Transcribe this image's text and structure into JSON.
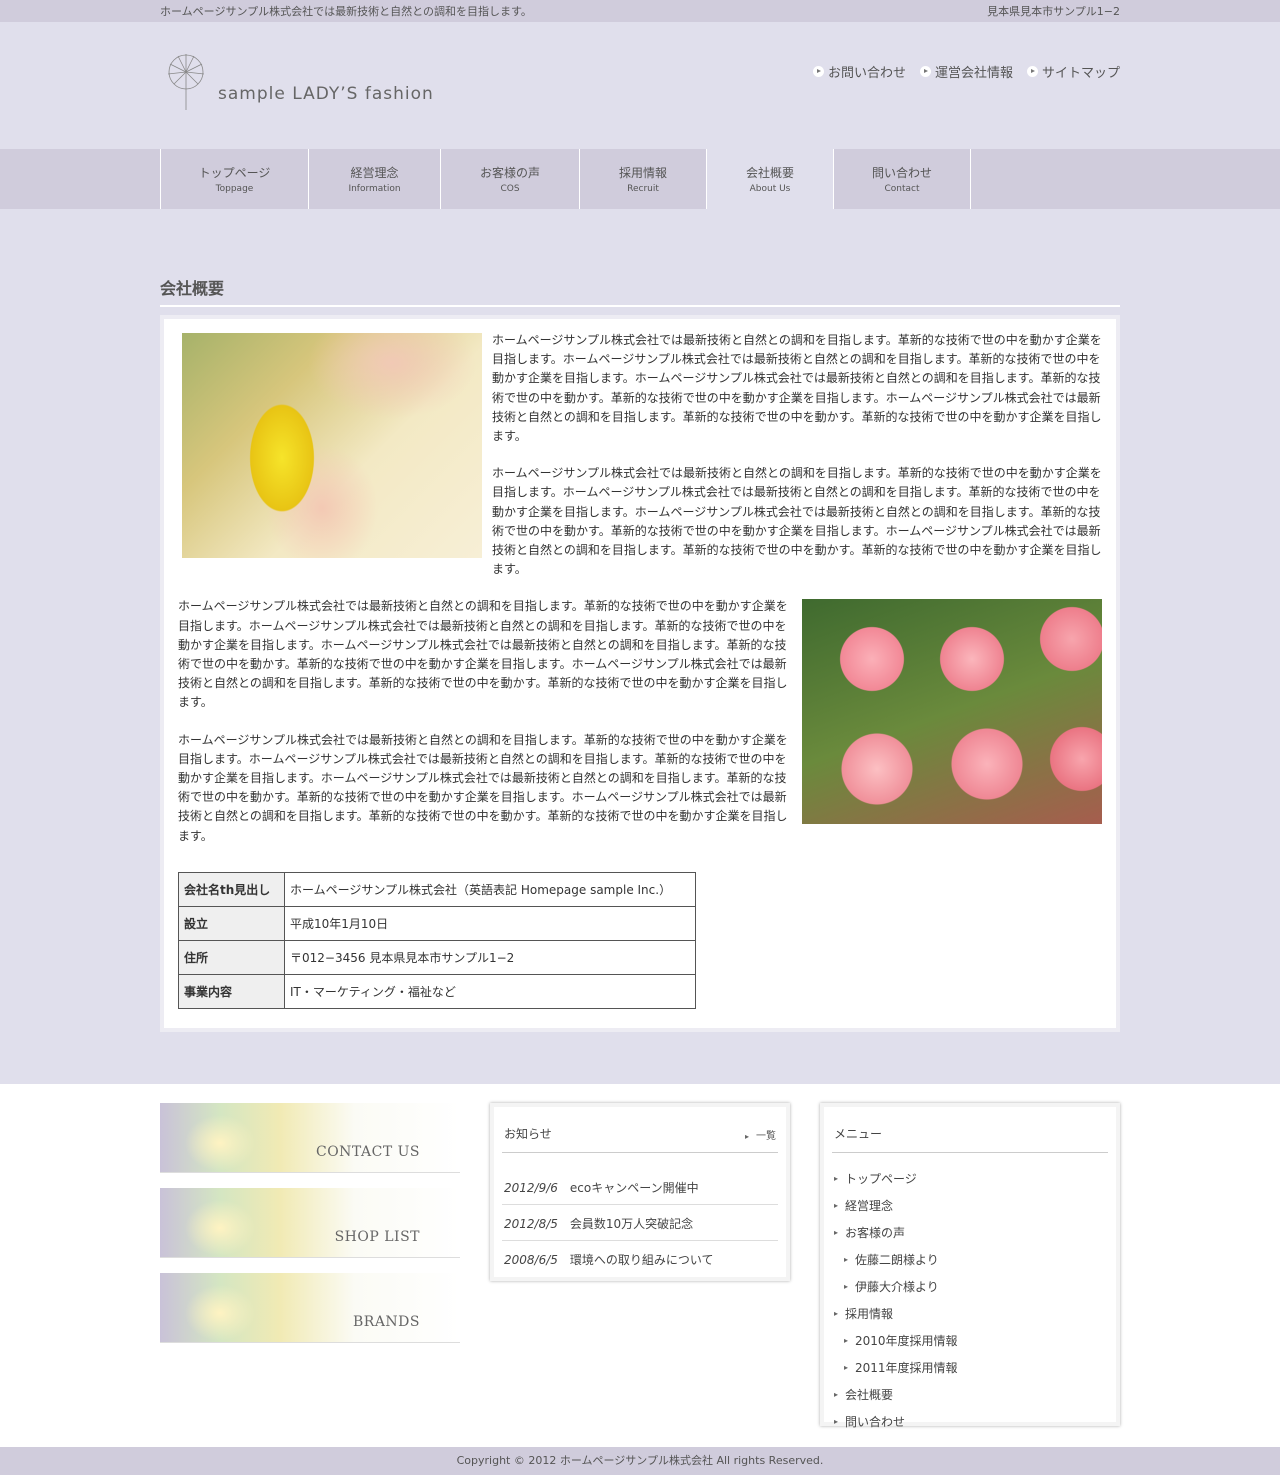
{
  "topbar": {
    "tagline": "ホームページサンプル株式会社では最新技術と自然との調和を目指します。",
    "address": "見本県見本市サンプル1−2"
  },
  "header": {
    "logo_text": "sample LADY’S fashion",
    "links": [
      "お問い合わせ",
      "運営会社情報",
      "サイトマップ"
    ]
  },
  "nav": [
    {
      "jp": "トップページ",
      "en": "Toppage"
    },
    {
      "jp": "経営理念",
      "en": "Information"
    },
    {
      "jp": "お客様の声",
      "en": "COS"
    },
    {
      "jp": "採用情報",
      "en": "Recruit"
    },
    {
      "jp": "会社概要",
      "en": "About Us"
    },
    {
      "jp": "問い合わせ",
      "en": "Contact"
    }
  ],
  "main": {
    "title": "会社概要",
    "paragraph": "ホームページサンプル株式会社では最新技術と自然との調和を目指します。革新的な技術で世の中を動かす企業を目指します。ホームページサンプル株式会社では最新技術と自然との調和を目指します。革新的な技術で世の中を動かす企業を目指します。ホームページサンプル株式会社では最新技術と自然との調和を目指します。革新的な技術で世の中を動かす。革新的な技術で世の中を動かす企業を目指します。ホームページサンプル株式会社では最新技術と自然との調和を目指します。革新的な技術で世の中を動かす。革新的な技術で世の中を動かす企業を目指します。",
    "table": [
      {
        "th": "会社名th見出し",
        "td": "ホームページサンプル株式会社（英語表記 Homepage sample Inc.）"
      },
      {
        "th": "設立",
        "td": "平成10年1月10日"
      },
      {
        "th": "住所",
        "td": "〒012−3456 見本県見本市サンプル1−2"
      },
      {
        "th": "事業内容",
        "td": "IT・マーケティング・福祉など"
      }
    ]
  },
  "banners": [
    "CONTACT US",
    "SHOP LIST",
    "BRANDS"
  ],
  "news": {
    "title": "お知らせ",
    "all_label": "一覧",
    "items": [
      {
        "date": "2012/9/6",
        "text": "ecoキャンペーン開催中"
      },
      {
        "date": "2012/8/5",
        "text": "会員数10万人突破記念"
      },
      {
        "date": "2008/6/5",
        "text": "環境への取り組みについて"
      }
    ]
  },
  "menu": {
    "title": "メニュー",
    "items": [
      {
        "label": "トップページ"
      },
      {
        "label": "経営理念"
      },
      {
        "label": "お客様の声"
      },
      {
        "label": "佐藤二朗様より"
      },
      {
        "label": "伊藤大介様より"
      },
      {
        "label": "採用情報"
      },
      {
        "label": "2010年度採用情報"
      },
      {
        "label": "2011年度採用情報"
      },
      {
        "label": "会社概要"
      },
      {
        "label": "問い合わせ"
      }
    ]
  },
  "copyright": "Copyright © 2012 ホームページサンプル株式会社 All rights Reserved."
}
